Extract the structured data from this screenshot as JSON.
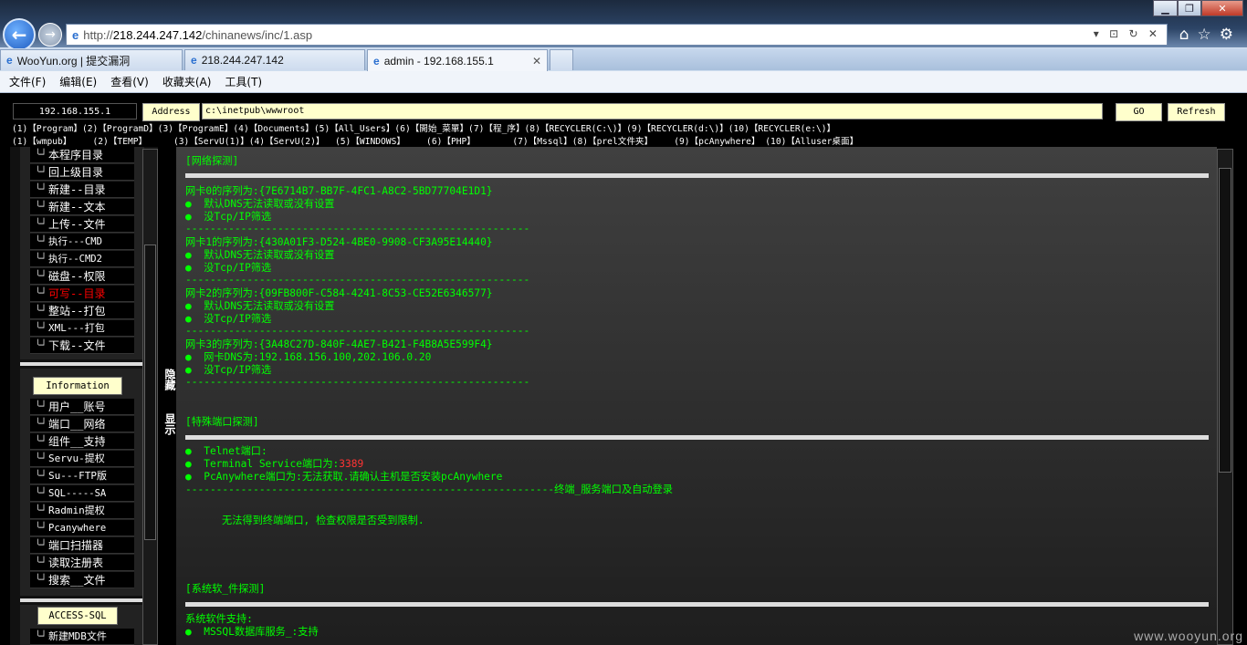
{
  "browser": {
    "url_prefix": "http://",
    "url_host": "218.244.247.142",
    "url_path": "/chinanews/inc/1.asp",
    "tabs": [
      "WooYun.org | 提交漏洞",
      "218.244.247.142",
      "admin - 192.168.155.1"
    ],
    "menu": [
      "文件(F)",
      "编辑(E)",
      "查看(V)",
      "收藏夹(A)",
      "工具(T)"
    ]
  },
  "toolbar": {
    "ip": "192.168.155.1",
    "address_label": "Address",
    "path": "c:\\inetpub\\wwwroot",
    "go": "GO",
    "refresh": "Refresh"
  },
  "quicklinks": {
    "row1": "(1)【Program】(2)【ProgramD】(3)【ProgramE】(4)【Documents】(5)【All_Users】(6)【開始_菜單】(7)【程_序】(8)【RECYCLER(C:\\)】(9)【RECYCLER(d:\\)】(10)【RECYCLER(e:\\)】",
    "row2": "(1)【wmpub】    (2)【TEMP】     (3)【ServU(1)】(4)【ServU(2)】  (5)【WINDOWS】    (6)【PHP】       (7)【Mssql】(8)【prel文件夹】    (9)【pcAnywhere】 (10)【Alluser桌面】"
  },
  "sidebar": {
    "group1": [
      "本程序目录",
      "回上级目录",
      "新建--目录",
      "新建--文本",
      "上传--文件",
      "执行---CMD",
      "执行--CMD2",
      "磁盘--权限",
      "可写--目录",
      "整站--打包",
      "XML---打包",
      "下载--文件"
    ],
    "info_label": "Information",
    "group2": [
      "用户__账号",
      "端口__网络",
      "组件__支持",
      "Servu-提权",
      "Su---FTP版",
      "SQL-----SA",
      "Radmin提权",
      "Pcanywhere",
      "端口扫描器",
      "读取注册表",
      "搜索__文件"
    ],
    "access_label": "ACCESS-SQL",
    "group3": [
      "新建MDB文件"
    ],
    "toggle_hide": "隐藏",
    "toggle_show": "显示"
  },
  "main": {
    "net_title": "[网络探测]",
    "nics": [
      {
        "serial": "网卡0的序列为:{7E6714B7-BB7F-4FC1-A8C2-5BD77704E1D1}",
        "l1": "●  默认DNS无法读取或没有设置",
        "l2": "●  没Tcp/IP筛选"
      },
      {
        "serial": "网卡1的序列为:{430A01F3-D524-4BE0-9908-CF3A95E14440}",
        "l1": "●  默认DNS无法读取或没有设置",
        "l2": "●  没Tcp/IP筛选"
      },
      {
        "serial": "网卡2的序列为:{09FB800F-C584-4241-8C53-CE52E6346577}",
        "l1": "●  默认DNS无法读取或没有设置",
        "l2": "●  没Tcp/IP筛选"
      },
      {
        "serial": "网卡3的序列为:{3A48C27D-840F-4AE7-B421-F4B8A5E599F4}",
        "l1": "●  网卡DNS为:192.168.156.100,202.106.0.20",
        "l2": "●  没Tcp/IP筛选"
      }
    ],
    "dashes": "--------------------------------------------------------",
    "port_title": "[特殊端口探测]",
    "telnet": "●  Telnet端口:",
    "ts_prefix": "●  Terminal Service端口为:",
    "ts_port": "3389",
    "pca": "●  PcAnywhere端口为:无法获取.请确认主机是否安装pcAnywhere",
    "term_line": "------------------------------------------------------------终端_服务端口及自动登录",
    "term_msg": "无法得到终端端口, 检查权限是否受到限制.",
    "sys_title": "[系统软_件探测]",
    "sys_support": "系统软件支持:",
    "mssql": "●  MSSQL数据库服务_:支持"
  },
  "watermark": "www.wooyun.org"
}
